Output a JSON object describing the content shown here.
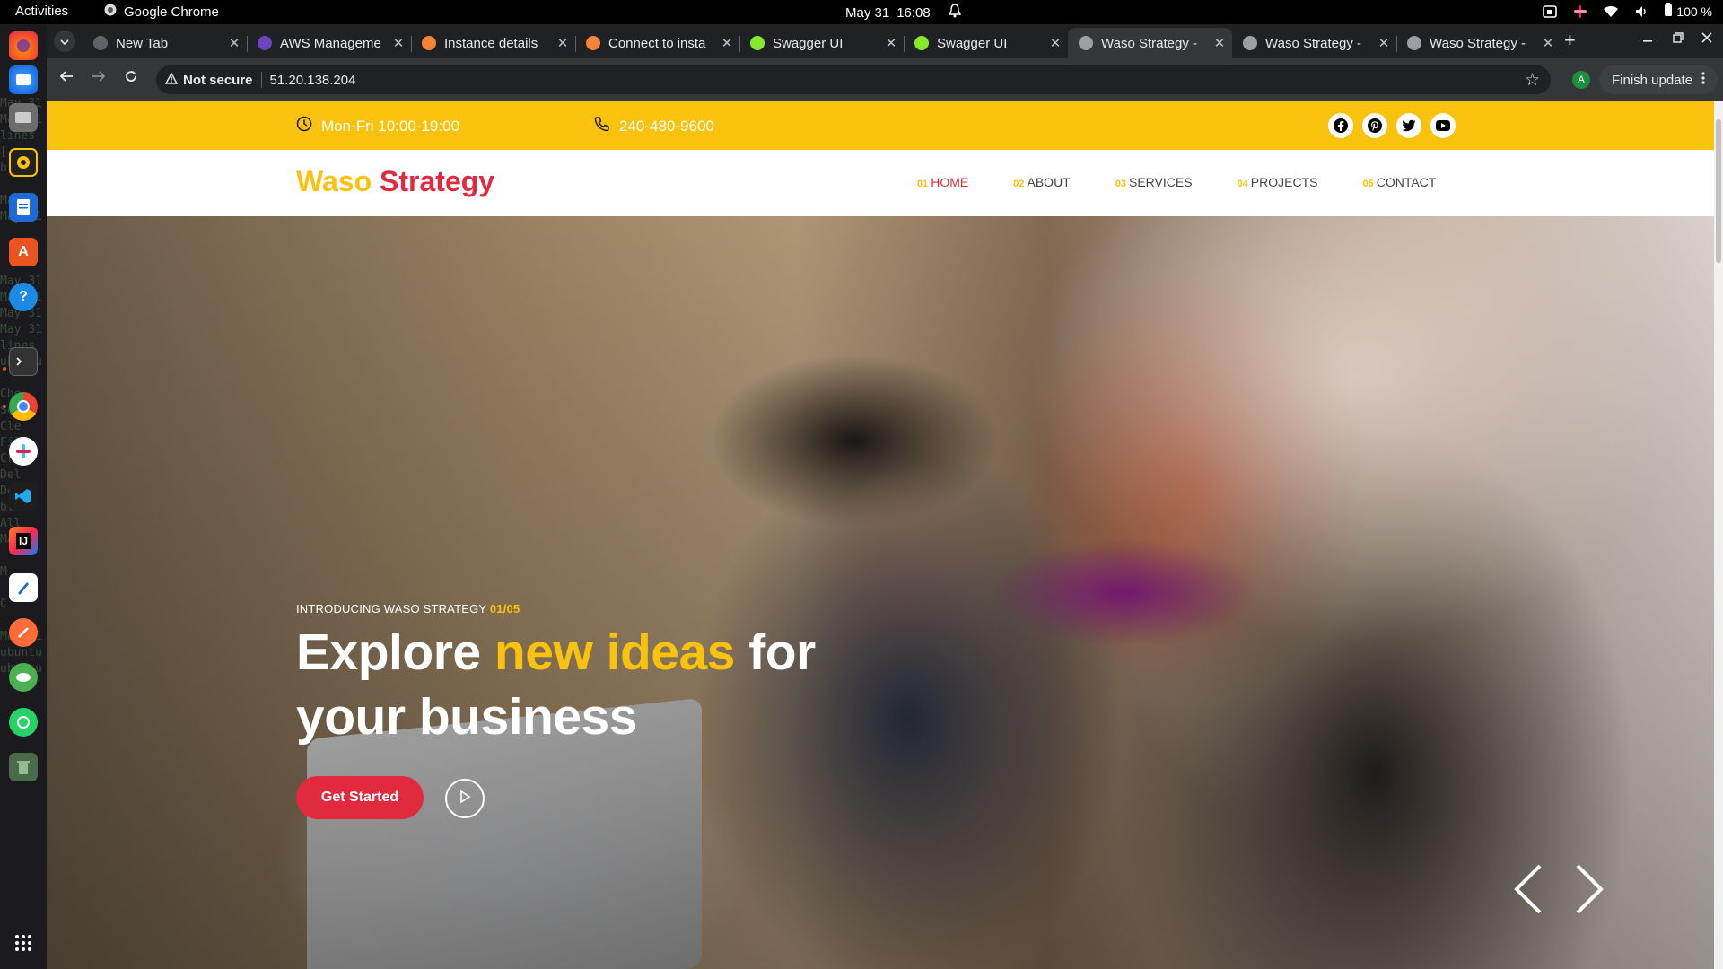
{
  "system_bar": {
    "activities": "Activities",
    "app_name": "Google Chrome",
    "date": "May 31",
    "time": "16:08",
    "battery": "100 %"
  },
  "dock": {
    "apps": [
      "firefox-icon",
      "thunderbird-icon",
      "files-icon",
      "rhythmbox-icon",
      "writer-icon",
      "software-center-icon",
      "help-icon",
      "terminal-icon",
      "chrome-icon",
      "slack-icon",
      "vscode-icon",
      "intellij-icon",
      "text-editor-icon",
      "postman-icon",
      "messaging-icon",
      "whatsapp-icon",
      "trash-icon",
      "show-apps-icon"
    ],
    "background_text": "May 31\nMay 31\nlines\n[\nbris\n\nMai\nMay 31\n\n\n\nMay 31\nMay 31\nMay 31\nMay 31\nlines\nubuntu\n\nChe\nSec\nCle\nFil\nCre\nDel\nDep\nblo\nAll\nMai\n\nM\n\nC\n\nMay 31\nubuntu\nubuntu"
  },
  "browser": {
    "tabs": [
      {
        "title": "New Tab",
        "favicon": "chrome-icon",
        "color": "#5f6368"
      },
      {
        "title": "AWS Manageme",
        "favicon": "aws-icon",
        "color": "#6b46c1"
      },
      {
        "title": "Instance details",
        "favicon": "aws-ec2-icon",
        "color": "#f58534"
      },
      {
        "title": "Connect to insta",
        "favicon": "aws-ec2-icon",
        "color": "#f58534"
      },
      {
        "title": "Swagger UI",
        "favicon": "swagger-icon",
        "color": "#85ea2d"
      },
      {
        "title": "Swagger UI",
        "favicon": "swagger-icon",
        "color": "#85ea2d"
      },
      {
        "title": "Waso Strategy -",
        "favicon": "globe-icon",
        "color": "#9aa0a6",
        "active": true
      },
      {
        "title": "Waso Strategy -",
        "favicon": "globe-icon",
        "color": "#9aa0a6"
      },
      {
        "title": "Waso Strategy -",
        "favicon": "globe-icon",
        "color": "#9aa0a6"
      }
    ],
    "security_label": "Not secure",
    "url": "51.20.138.204",
    "profile_initial": "A",
    "finish_update": "Finish update"
  },
  "site": {
    "info_bar": {
      "hours": "Mon-Fri 10:00-19:00",
      "phone": "240-480-9600",
      "social": [
        "facebook-icon",
        "pinterest-icon",
        "twitter-icon",
        "youtube-icon"
      ]
    },
    "logo": {
      "word1": "Waso",
      "word2": "Strategy"
    },
    "nav": [
      {
        "num": "01",
        "label": "HOME",
        "active": true
      },
      {
        "num": "02",
        "label": "ABOUT"
      },
      {
        "num": "03",
        "label": "SERVICES"
      },
      {
        "num": "04",
        "label": "PROJECTS"
      },
      {
        "num": "05",
        "label": "CONTACT"
      }
    ],
    "hero": {
      "tagline": "INTRODUCING WASO STRATEGY",
      "slide_counter": "01/05",
      "heading_part1": "Explore",
      "heading_highlight": "new ideas",
      "heading_part2": "for your business",
      "cta": "Get Started"
    },
    "colors": {
      "brand_yellow": "#f9c20c",
      "brand_red": "#e12a3d"
    }
  }
}
